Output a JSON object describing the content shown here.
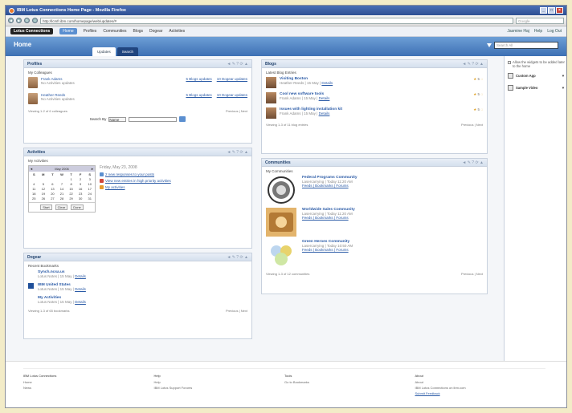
{
  "browser": {
    "title": "IBM Lotus Connections Home Page - Mozilla Firefox",
    "url": "http://lcmfr.ibm.com/homepage/web/updates/#",
    "search_placeholder": "Google"
  },
  "appnav": {
    "brand": "Lotus Connections",
    "items": [
      "Home",
      "Profiles",
      "Communities",
      "Blogs",
      "Dogear",
      "Activities"
    ],
    "user": "Jasmine Haj",
    "help": "Help",
    "logout": "Log Out"
  },
  "banner": {
    "title": "Home",
    "tabs": [
      "Updates",
      "Search"
    ],
    "search_placeholder": "Search All"
  },
  "profiles": {
    "title": "Profiles",
    "subheading": "My Colleagues",
    "people": [
      {
        "name": "Frank Adams",
        "status": "No Activities updates",
        "link1": "5 Blogs updates",
        "link2": "10 Dogear updates"
      },
      {
        "name": "Heather Reeds",
        "status": "No Activities updates",
        "link1": "5 Blogs updates",
        "link2": "10 Dogear updates"
      }
    ],
    "footer_left": "Viewing 1-2 of 6 colleagues",
    "footer_right": "Previous | Next",
    "search_label": "Search By",
    "search_option": "Name"
  },
  "activities": {
    "title": "Activities",
    "subheading": "My Activities",
    "calendar": {
      "month": "May 2006",
      "days": [
        "S",
        "M",
        "T",
        "W",
        "T",
        "F",
        "S"
      ],
      "dates": [
        "",
        "",
        "",
        "",
        "1",
        "2",
        "3",
        "4",
        "5",
        "6",
        "7",
        "8",
        "9",
        "10",
        "11",
        "12",
        "13",
        "14",
        "15",
        "16",
        "17",
        "18",
        "19",
        "20",
        "21",
        "22",
        "23",
        "24",
        "25",
        "26",
        "27",
        "28",
        "29",
        "30",
        "31",
        "",
        ""
      ],
      "buttons": [
        "Start",
        "Clear",
        "Done"
      ]
    },
    "date_heading": "Friday, May 23, 2008",
    "items": [
      "2 new responses to your posts",
      "View new entries in high priority activities",
      "My activities"
    ]
  },
  "dogear": {
    "title": "Dogear",
    "subheading": "Recent Bookmarks",
    "bookmarks": [
      {
        "title": "Synch.ncsa.us",
        "meta": "Lotus Notes | 15 May |",
        "link": "Details"
      },
      {
        "title": "IBM United States",
        "meta": "Lotus Notes | 15 May |",
        "link": "Details"
      },
      {
        "title": "My Activities",
        "meta": "Lotus Notes | 15 May |",
        "link": "Details"
      }
    ],
    "footer_left": "Viewing 1-3 of 65 bookmarks",
    "footer_right": "Previous | Next"
  },
  "blogs": {
    "title": "Blogs",
    "subheading": "Latest Blog Entries",
    "entries": [
      {
        "title": "Visiting Boston",
        "meta": "Heather Reeds | 15 May |",
        "link": "Details",
        "rating": "5"
      },
      {
        "title": "Cool new software tools",
        "meta": "Frank Adams | 15 May |",
        "link": "Details",
        "rating": "5"
      },
      {
        "title": "Issues with lighting installation kit",
        "meta": "Frank Adams | 15 May |",
        "link": "Details",
        "rating": "5"
      }
    ],
    "footer_left": "Viewing 1-3 of 11 blog entries",
    "footer_right": "Previous | Next"
  },
  "communities": {
    "title": "Communities",
    "subheading": "My Communities",
    "items": [
      {
        "title": "Federal Programs Community",
        "meta": "Lasercarrying | Today 11:20 AM",
        "links": "Feeds | Bookmarks | Forums"
      },
      {
        "title": "Worldwide Sales Community",
        "meta": "Lasercarrying | Today 11:20 AM",
        "links": "Feeds | Bookmarks | Forums"
      },
      {
        "title": "Green Heroes Community",
        "meta": "Lasercarrying | Today 10:50 AM",
        "links": "Feeds | Bookmarks | Forums"
      }
    ],
    "footer_left": "Viewing 1-3 of 12 communities",
    "footer_right": "Previous | Next"
  },
  "right_pane": {
    "checkbox_text": "Allow the widgets to be added later to the home",
    "items": [
      "Custom App",
      "Sample Video"
    ]
  },
  "footer": {
    "columns": [
      {
        "heading": "IBM Lotus Connections",
        "links": [
          "Home",
          "News"
        ]
      },
      {
        "heading": "Help",
        "links": [
          "Help",
          "IBM Lotus Support Forums"
        ]
      },
      {
        "heading": "Tools",
        "links": [
          "Go to Bookmarks"
        ]
      },
      {
        "heading": "About",
        "links": [
          "About",
          "IBM Lotus Connections on ibm.com",
          "Submit Feedback"
        ]
      }
    ]
  }
}
